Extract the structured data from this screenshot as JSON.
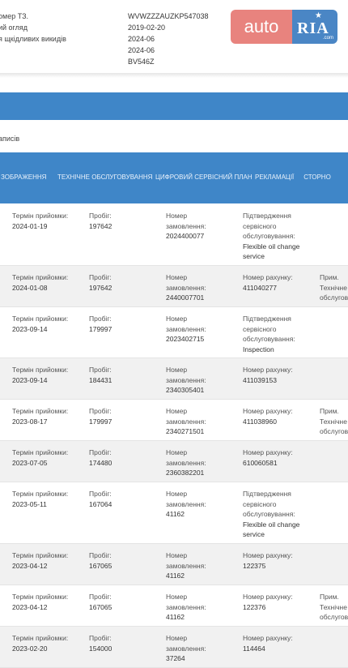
{
  "header": {
    "labels": [
      "омер ТЗ.",
      "ий огляд",
      "я щкідливих викидів"
    ],
    "values": [
      "WVWZZZAUZKP547038",
      "2019-02-20",
      "2024-06",
      "2024-06",
      "BV546Z"
    ]
  },
  "logo": {
    "auto": "auto",
    "ria": "RIA",
    "com": ".com"
  },
  "records_label": "аписів",
  "tabs": [
    "ЗОБРАЖЕННЯ",
    "ТЕХНІЧНЕ ОБСЛУГОВУВАННЯ",
    "ЦИФРОВИЙ СЕРВІСНИЙ ПЛАН",
    "РЕКЛАМАЦІЇ",
    "СТОРНО"
  ],
  "rows": [
    {
      "shade": false,
      "date_label": "Термін прийомки:",
      "date": "2024-01-19",
      "km_label": "Пробіг:",
      "km": "197642",
      "order_label": [
        "Номер",
        "замовлення:"
      ],
      "order": "2024400077",
      "c4_label": [
        "Підтвердження",
        "сервісного",
        "обслуговування:"
      ],
      "c4_value": [
        "Flexible oil change",
        "service"
      ],
      "note": []
    },
    {
      "shade": true,
      "date_label": "Термін прийомки:",
      "date": "2024-01-08",
      "km_label": "Пробіг:",
      "km": "197642",
      "order_label": [
        "Номер",
        "замовлення:"
      ],
      "order": "2440007701",
      "c4_label": [
        "Номер рахунку:"
      ],
      "c4_value": [
        "411040277"
      ],
      "note": [
        "Прим.",
        "Технічне",
        "обслугов"
      ]
    },
    {
      "shade": false,
      "date_label": "Термін прийомки:",
      "date": "2023-09-14",
      "km_label": "Пробіг:",
      "km": "179997",
      "order_label": [
        "Номер",
        "замовлення:"
      ],
      "order": "2023402715",
      "c4_label": [
        "Підтвердження",
        "сервісного",
        "обслуговування:"
      ],
      "c4_value": [
        "Inspection"
      ],
      "note": []
    },
    {
      "shade": true,
      "date_label": "Термін прийомки:",
      "date": "2023-09-14",
      "km_label": "Пробіг:",
      "km": "184431",
      "order_label": [
        "Номер",
        "замовлення:"
      ],
      "order": "2340305401",
      "c4_label": [
        "Номер рахунку:"
      ],
      "c4_value": [
        "411039153"
      ],
      "note": []
    },
    {
      "shade": false,
      "date_label": "Термін прийомки:",
      "date": "2023-08-17",
      "km_label": "Пробіг:",
      "km": "179997",
      "order_label": [
        "Номер",
        "замовлення:"
      ],
      "order": "2340271501",
      "c4_label": [
        "Номер рахунку:"
      ],
      "c4_value": [
        "411038960"
      ],
      "note": [
        "Прим.",
        "Технічне",
        "обслугов"
      ]
    },
    {
      "shade": true,
      "date_label": "Термін прийомки:",
      "date": "2023-07-05",
      "km_label": "Пробіг:",
      "km": "174480",
      "order_label": [
        "Номер",
        "замовлення:"
      ],
      "order": "2360382201",
      "c4_label": [
        "Номер рахунку:"
      ],
      "c4_value": [
        "610060581"
      ],
      "note": []
    },
    {
      "shade": false,
      "date_label": "Термін прийомки:",
      "date": "2023-05-11",
      "km_label": "Пробіг:",
      "km": "167064",
      "order_label": [
        "Номер",
        "замовлення:"
      ],
      "order": "41162",
      "c4_label": [
        "Підтвердження",
        "сервісного",
        "обслуговування:"
      ],
      "c4_value": [
        "Flexible oil change",
        "service"
      ],
      "note": []
    },
    {
      "shade": true,
      "date_label": "Термін прийомки:",
      "date": "2023-04-12",
      "km_label": "Пробіг:",
      "km": "167065",
      "order_label": [
        "Номер",
        "замовлення:"
      ],
      "order": "41162",
      "c4_label": [
        "Номер рахунку:"
      ],
      "c4_value": [
        "122375"
      ],
      "note": []
    },
    {
      "shade": false,
      "date_label": "Термін прийомки:",
      "date": "2023-04-12",
      "km_label": "Пробіг:",
      "km": "167065",
      "order_label": [
        "Номер",
        "замовлення:"
      ],
      "order": "41162",
      "c4_label": [
        "Номер рахунку:"
      ],
      "c4_value": [
        "122376"
      ],
      "note": [
        "Прим.",
        "Технічне",
        "обслугов"
      ]
    },
    {
      "shade": true,
      "date_label": "Термін прийомки:",
      "date": "2023-02-20",
      "km_label": "Пробіг:",
      "km": "154000",
      "order_label": [
        "Номер",
        "замовлення:"
      ],
      "order": "37264",
      "c4_label": [
        "Номер рахунку:"
      ],
      "c4_value": [
        "114464"
      ],
      "note": []
    }
  ]
}
